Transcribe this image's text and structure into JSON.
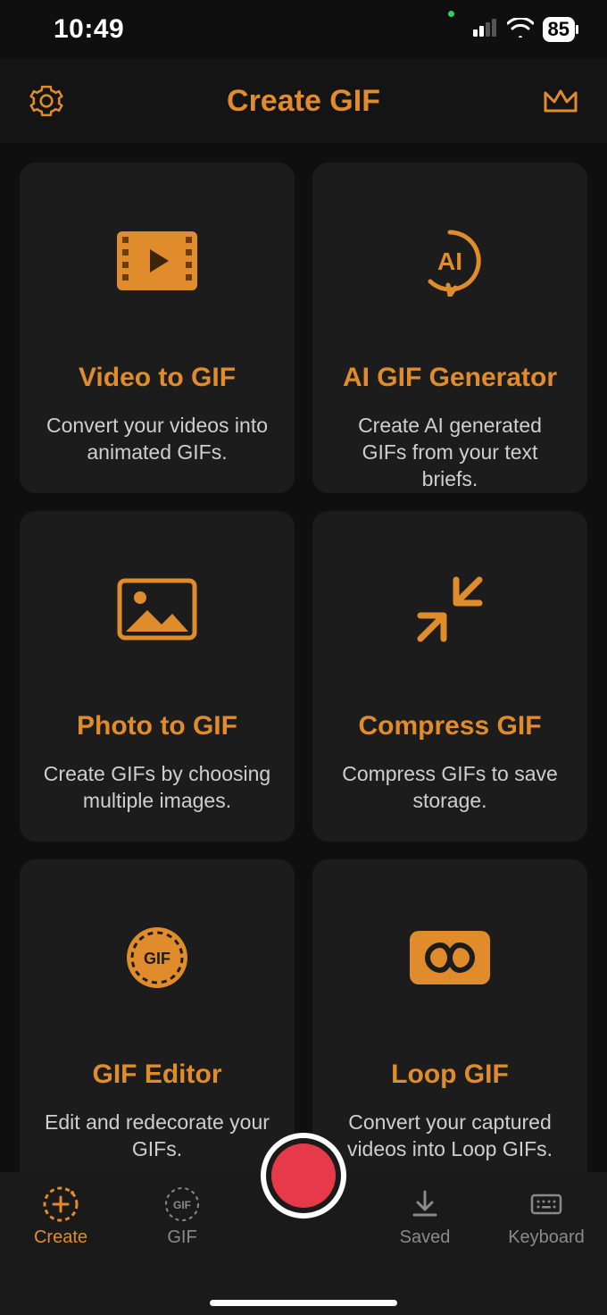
{
  "status": {
    "time": "10:49",
    "battery": "85"
  },
  "header": {
    "title": "Create GIF"
  },
  "cards": [
    {
      "title": "Video to GIF",
      "desc": "Convert your videos into animated GIFs."
    },
    {
      "title": "AI GIF Generator",
      "desc": "Create AI generated GIFs from your text briefs."
    },
    {
      "title": "Photo to GIF",
      "desc": "Create GIFs by choosing multiple images."
    },
    {
      "title": "Compress GIF",
      "desc": "Compress GIFs to save storage."
    },
    {
      "title": "GIF Editor",
      "desc": "Edit and redecorate your GIFs."
    },
    {
      "title": "Loop GIF",
      "desc": "Convert your captured videos into Loop GIFs."
    }
  ],
  "tabs": {
    "create": "Create",
    "gif": "GIF",
    "saved": "Saved",
    "keyboard": "Keyboard"
  },
  "colors": {
    "accent": "#e08c2c"
  }
}
